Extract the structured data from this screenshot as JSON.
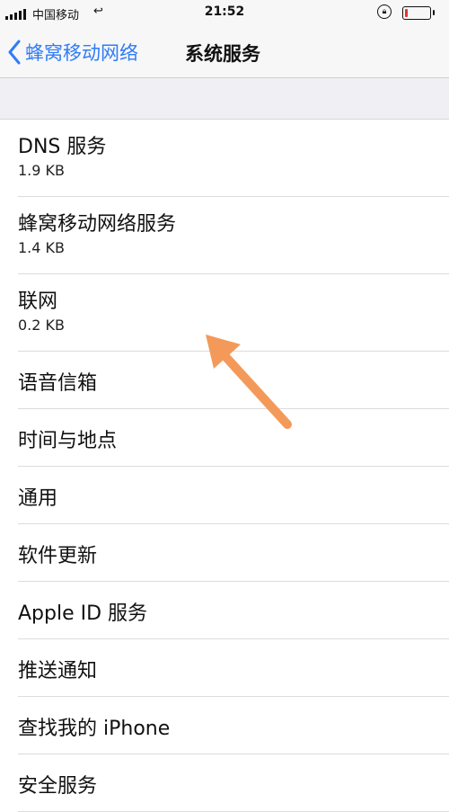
{
  "status_bar": {
    "carrier": "中国移动",
    "time": "21:52",
    "battery_level": 0.12,
    "battery_color": "#e33333"
  },
  "nav": {
    "back_label": "蜂窝移动网络",
    "title": "系统服务",
    "accent_color": "#2f7cf6"
  },
  "services": [
    {
      "title": "DNS 服务",
      "detail": "1.9 KB"
    },
    {
      "title": "蜂窝移动网络服务",
      "detail": "1.4 KB"
    },
    {
      "title": "联网",
      "detail": "0.2 KB"
    },
    {
      "title": "语音信箱"
    },
    {
      "title": "时间与地点"
    },
    {
      "title": "通用"
    },
    {
      "title": "软件更新"
    },
    {
      "title": "Apple ID 服务"
    },
    {
      "title": "推送通知"
    },
    {
      "title": "查找我的 iPhone"
    },
    {
      "title": "安全服务"
    }
  ],
  "annotation": {
    "icon": "arrow-up-left-icon",
    "color": "#f39a5a"
  }
}
